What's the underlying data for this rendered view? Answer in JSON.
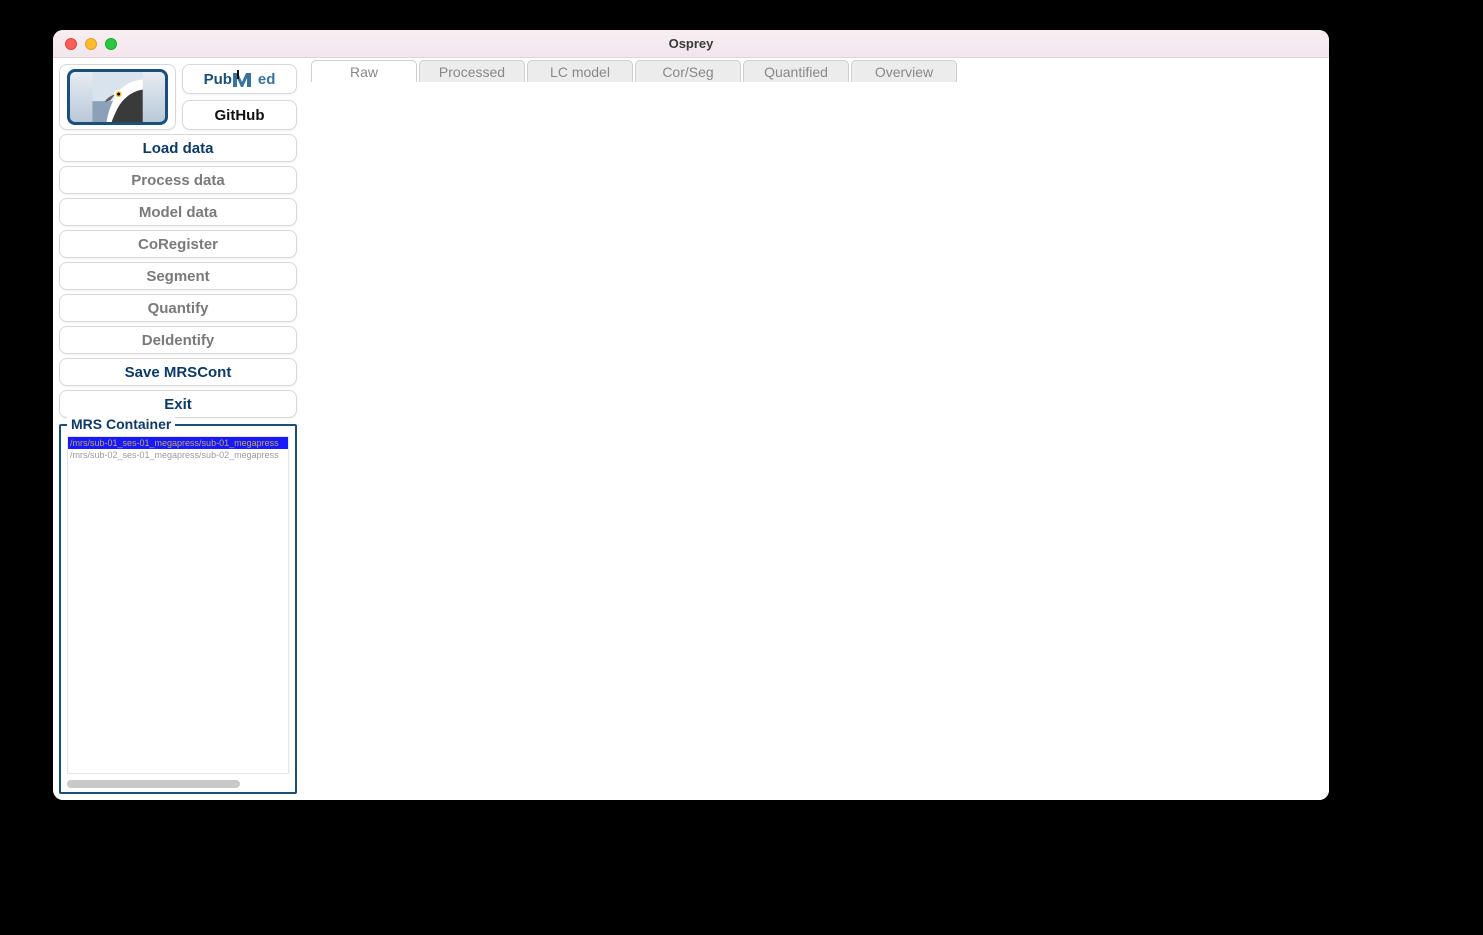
{
  "window": {
    "title": "Osprey"
  },
  "sidebar": {
    "links": {
      "pubmed_label": "PubMed",
      "github_label": "GitHub"
    },
    "buttons": [
      {
        "key": "load",
        "label": "Load data",
        "enabled": true
      },
      {
        "key": "process",
        "label": "Process data",
        "enabled": false
      },
      {
        "key": "model",
        "label": "Model data",
        "enabled": false
      },
      {
        "key": "coreg",
        "label": "CoRegister",
        "enabled": false
      },
      {
        "key": "segment",
        "label": "Segment",
        "enabled": false
      },
      {
        "key": "quantify",
        "label": "Quantify",
        "enabled": false
      },
      {
        "key": "deid",
        "label": "DeIdentify",
        "enabled": false
      },
      {
        "key": "save",
        "label": "Save MRSCont",
        "enabled": true
      },
      {
        "key": "exit",
        "label": "Exit",
        "enabled": true
      }
    ],
    "mrs_container": {
      "legend": "MRS Container",
      "items": [
        {
          "path": "/mrs/sub-01_ses-01_megapress/sub-01_megapress",
          "selected": true
        },
        {
          "path": "/mrs/sub-02_ses-01_megapress/sub-02_megapress",
          "selected": false
        }
      ]
    }
  },
  "tabs": [
    {
      "key": "raw",
      "label": "Raw",
      "active": true
    },
    {
      "key": "processed",
      "label": "Processed",
      "active": false
    },
    {
      "key": "lcmodel",
      "label": "LC model",
      "active": false
    },
    {
      "key": "corseg",
      "label": "Cor/Seg",
      "active": false
    },
    {
      "key": "quantified",
      "label": "Quantified",
      "active": false
    },
    {
      "key": "overview",
      "label": "Overview",
      "active": false
    }
  ]
}
